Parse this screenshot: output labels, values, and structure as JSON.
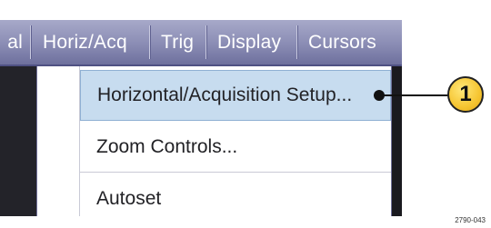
{
  "menubar": {
    "items": [
      {
        "label": "al"
      },
      {
        "label": "Horiz/Acq"
      },
      {
        "label": "Trig"
      },
      {
        "label": "Display"
      },
      {
        "label": "Cursors"
      }
    ]
  },
  "dropdown": {
    "items": [
      {
        "label": "Horizontal/Acquisition Setup..."
      },
      {
        "label": "Zoom Controls..."
      },
      {
        "label": "Autoset"
      }
    ],
    "highlighted_index": 0
  },
  "callout": {
    "number": "1"
  },
  "figure_id": "2790-043",
  "colors": {
    "menubar": "#8a8cb4",
    "highlight": "#c7dcef",
    "callout": "#f6c531"
  }
}
